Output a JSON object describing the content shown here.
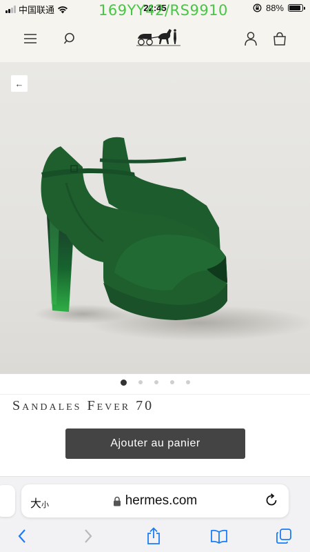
{
  "status_bar": {
    "carrier": "中国联通",
    "time": "22:45",
    "battery_percent": "88%",
    "battery_level": 0.88,
    "watermark": "169YY42/RS9910"
  },
  "header": {
    "menu_icon": "hamburger-icon",
    "search_icon": "search-icon",
    "logo_icon": "horse-carriage-logo",
    "account_icon": "user-icon",
    "cart_icon": "shopping-bag-icon"
  },
  "gallery": {
    "back_label": "←",
    "image_subject": "green suede platform sandals with translucent green heels",
    "dots_total": 5,
    "active_index": 0
  },
  "product": {
    "title": "Sandales Fever 70"
  },
  "cta": {
    "add_to_cart": "Ajouter au panier"
  },
  "browser": {
    "text_size_label_big": "大",
    "text_size_label_small": "小",
    "lock_icon": "lock-icon",
    "url": "hermes.com",
    "reload_icon": "reload-icon",
    "toolbar": [
      "back-icon",
      "forward-icon",
      "share-icon",
      "bookmarks-icon",
      "tabs-icon"
    ]
  },
  "colors": {
    "accent_blue": "#1a7cf5",
    "cta_bg": "#444444",
    "header_bg": "#f6f4ee",
    "watermark": "#3ec43e",
    "shoe_green": "#1f5a2c"
  }
}
